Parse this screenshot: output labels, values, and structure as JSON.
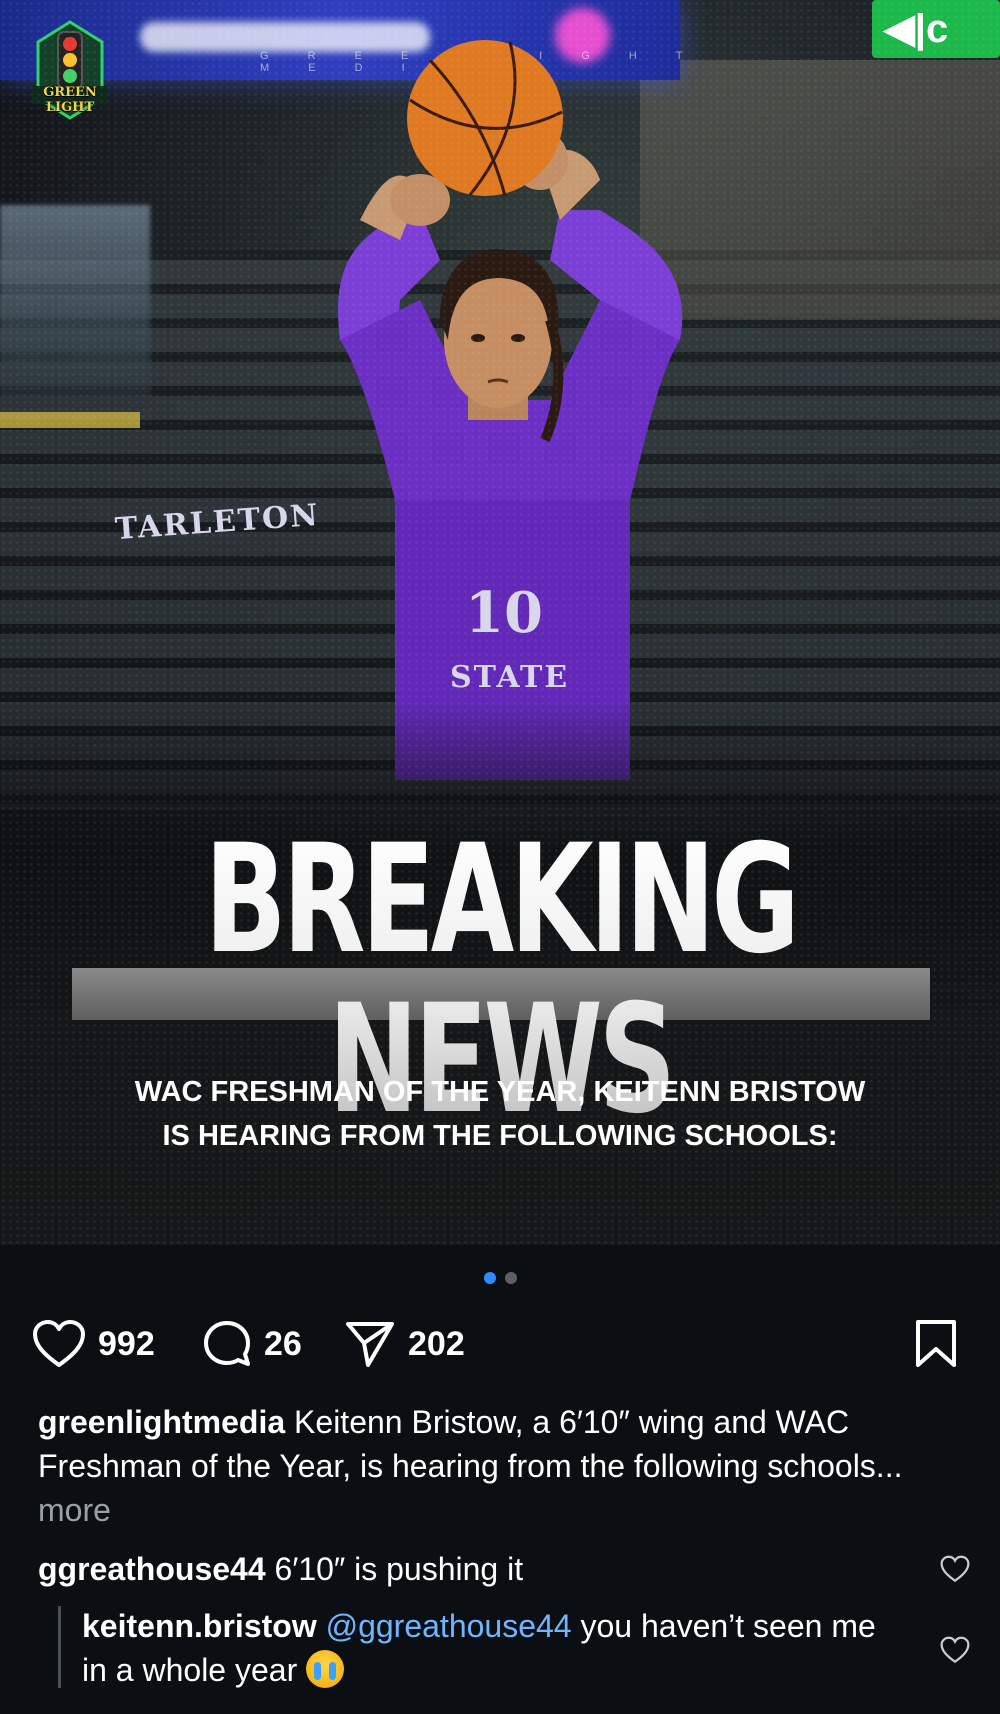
{
  "post": {
    "watermark": "G R E E N   L I G H T   M E D I A",
    "logo_text": "GREEN LIGHT",
    "jersey": {
      "school_top": "TARLETON",
      "number": "10",
      "school_bottom": "STATE"
    },
    "headline": "BREAKING NEWS",
    "subheadline_line1": "WAC FRESHMAN OF THE YEAR, KEITENN BRISTOW",
    "subheadline_line2": "IS HEARING FROM THE FOLLOWING SCHOOLS:",
    "carousel": {
      "total": 2,
      "active_index": 0
    }
  },
  "actions": {
    "likes": "992",
    "comments": "26",
    "shares": "202"
  },
  "caption": {
    "username": "greenlightmedia",
    "text": "Keitenn Bristow, a 6′10″ wing and WAC Freshman of the Year, is hearing from the following schools...",
    "more": "more"
  },
  "comments": [
    {
      "username": "ggreathouse44",
      "text": "6′10″ is pushing it"
    },
    {
      "username": "keitenn.bristow",
      "mention": "@ggreathouse44",
      "text": "you haven’t seen me in a whole year"
    }
  ],
  "colors": {
    "background": "#0b0f14",
    "accent_blue": "#2f8cff",
    "mention": "#6fb6ff",
    "jersey_purple": "#7a3fd0"
  }
}
